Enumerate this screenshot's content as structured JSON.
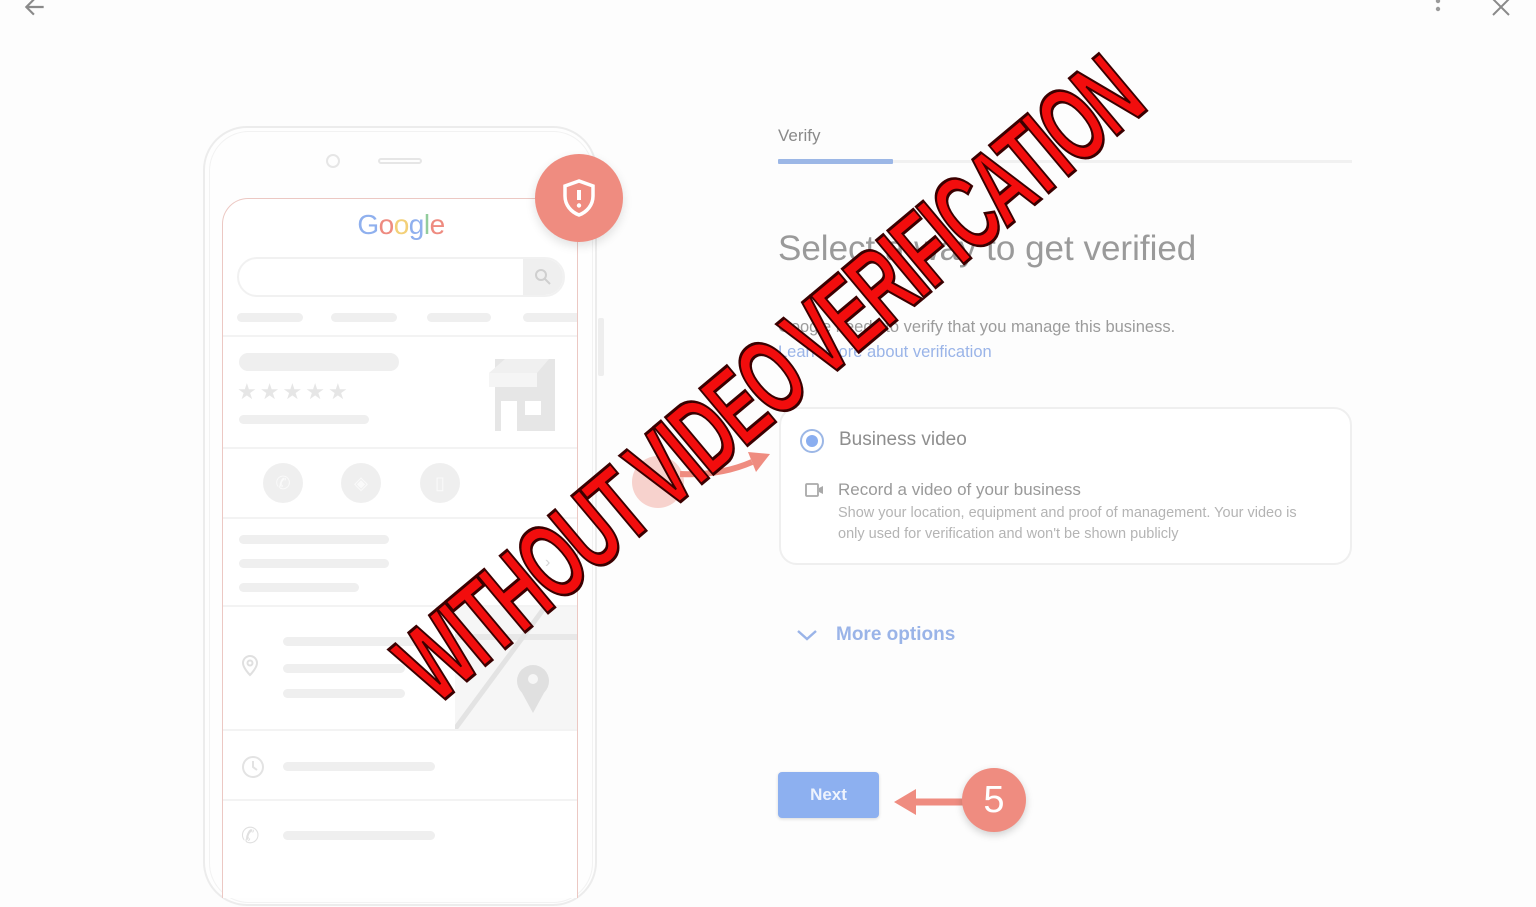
{
  "window": {
    "back_icon": "arrow-left-icon",
    "menu_icon": "more-vert-icon",
    "close_icon": "close-icon"
  },
  "phone_illustration": {
    "logo_text": "Google",
    "logo_colors": [
      "#8fb0ee",
      "#ee8b80",
      "#f3d078",
      "#8fb0ee",
      "#92cc9c",
      "#ee8b80"
    ],
    "badge_icon": "shield-alert-icon",
    "badge_color": "#ef8c80",
    "stars": 5,
    "action_icons": [
      "phone-icon",
      "directions-icon",
      "bookmark-icon"
    ],
    "row_icons": [
      "location-pin-icon",
      "clock-icon",
      "phone-icon"
    ]
  },
  "verify": {
    "tab_label": "Verify",
    "tab_progress": 0.2,
    "heading": "Select a way to get verified",
    "description": "Google needs to verify that you manage this business.",
    "learn_more_link": "Learn more about verification",
    "option": {
      "title": "Business video",
      "selected": true,
      "method_icon": "video-camera-icon",
      "method_title": "Record a video of your business",
      "method_description": "Show your location, equipment and proof of management. Your video is only used for verification and won't be shown publicly"
    },
    "more_options_label": "More options",
    "next_label": "Next"
  },
  "annotations": {
    "step_number": "5",
    "overlay_text": "WITHOUT VIDEO VERIFICATION",
    "overlay_color": "#f20d0d",
    "accent_color": "#8db0f0"
  }
}
